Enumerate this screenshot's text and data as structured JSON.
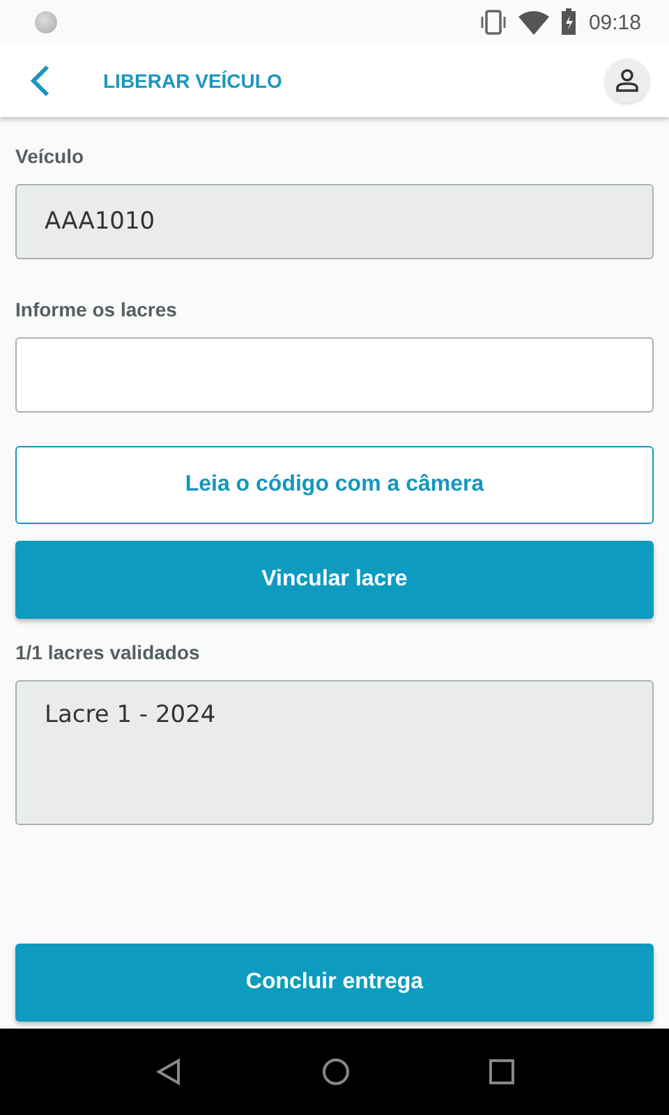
{
  "status_bar": {
    "time": "09:18"
  },
  "header": {
    "title": "LIBERAR VEÍCULO"
  },
  "vehicle_field": {
    "label": "Veículo",
    "value": "AAA1010",
    "disabled": true
  },
  "seal_field": {
    "label": "Informe os lacres",
    "disabled": false
  },
  "buttons": [
    {
      "label": "Leia o código com a câmera",
      "kind": "outline"
    },
    {
      "label": "Vincular lacre",
      "kind": "filled"
    }
  ],
  "validated": {
    "label": "1/1 lacres validados",
    "items": [
      "Lacre 1 - 2024"
    ]
  },
  "footer_button": {
    "label": "Concluir entrega"
  }
}
